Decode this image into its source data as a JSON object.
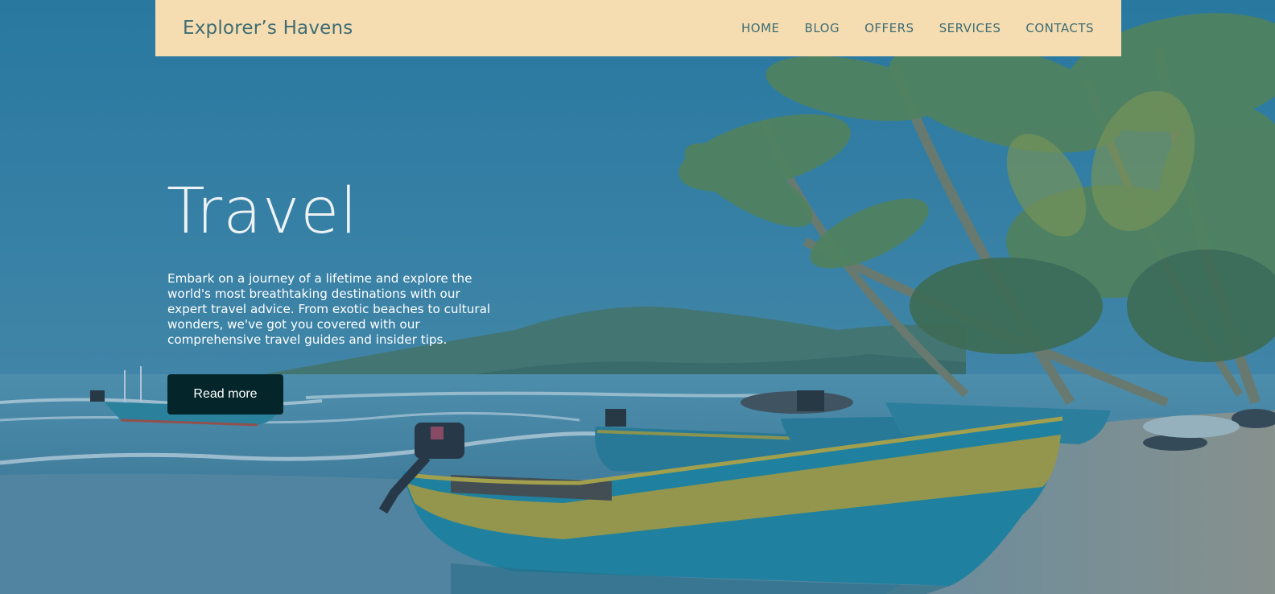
{
  "brand": {
    "name": "Explorer’s Havens"
  },
  "nav": {
    "items": [
      {
        "label": "HOME"
      },
      {
        "label": "BLOG"
      },
      {
        "label": "OFFERS"
      },
      {
        "label": "SERVICES"
      },
      {
        "label": "CONTACTS"
      }
    ]
  },
  "hero": {
    "title": "Travel",
    "description": "Embark on a journey of a lifetime and explore the world's most breathtaking destinations with our expert travel advice. From exotic beaches to cultural wonders, we've got you covered with our comprehensive travel guides and insider tips.",
    "button_label": "Read more"
  },
  "colors": {
    "navbar_bg": "#f5ddb1",
    "nav_text": "#3e6c74",
    "button_bg": "#04262a",
    "sky": "#3f87ac",
    "sea": "#4a89a8",
    "sand": "#8f9c9e",
    "boat_teal": "#1f8aa4",
    "boat_yellow": "#b4a53a"
  }
}
